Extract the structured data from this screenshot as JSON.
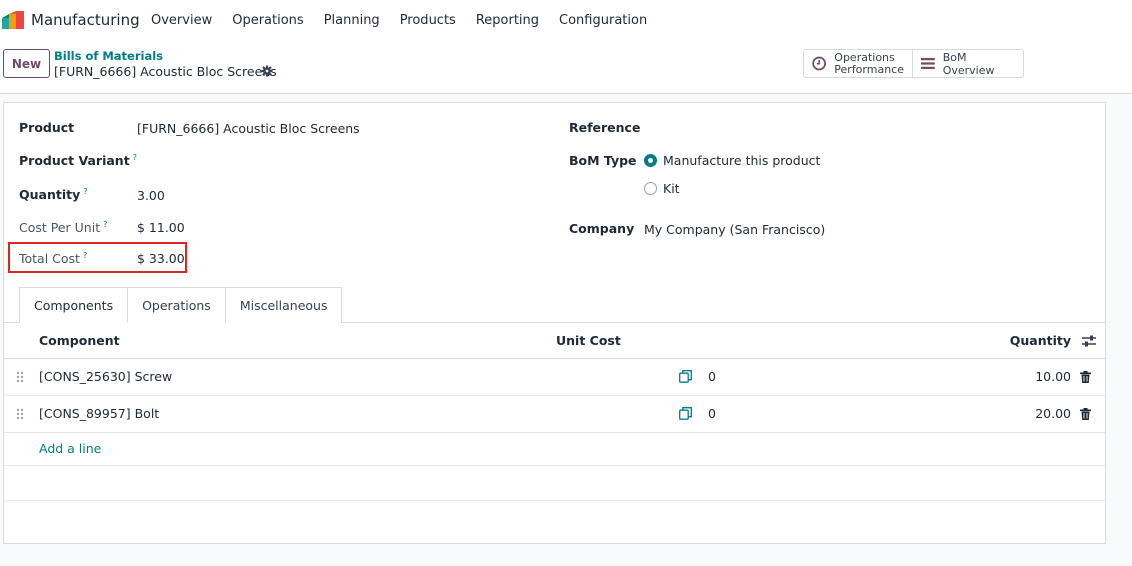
{
  "navbar": {
    "app_name": "Manufacturing",
    "menu": [
      "Overview",
      "Operations",
      "Planning",
      "Products",
      "Reporting",
      "Configuration"
    ]
  },
  "control_panel": {
    "new_label": "New",
    "breadcrumb_parent": "Bills of Materials",
    "breadcrumb_current": "[FURN_6666] Acoustic Bloc Screens",
    "stat_buttons": {
      "operations_line1": "Operations",
      "operations_line2": "Performance",
      "bom_overview": "BoM Overview"
    }
  },
  "form": {
    "product_label": "Product",
    "product_value": "[FURN_6666] Acoustic Bloc Screens",
    "variant_label": "Product Variant",
    "quantity_label": "Quantity",
    "quantity_value": "3.00",
    "cost_per_unit_label": "Cost Per Unit",
    "cost_per_unit_value": "$ 11.00",
    "total_cost_label": "Total Cost",
    "total_cost_value": "$ 33.00",
    "help_mark": "?",
    "reference_label": "Reference",
    "bom_type_label": "BoM Type",
    "bom_type_options": [
      "Manufacture this product",
      "Kit"
    ],
    "bom_type_selected": "Manufacture this product",
    "company_label": "Company",
    "company_value": "My Company (San Francisco)"
  },
  "tabs": [
    "Components",
    "Operations",
    "Miscellaneous"
  ],
  "active_tab": "Components",
  "components_table": {
    "headers": {
      "component": "Component",
      "unit_cost": "Unit Cost",
      "quantity": "Quantity"
    },
    "rows": [
      {
        "component": "[CONS_25630] Screw",
        "unit_cost": "0",
        "quantity": "10.00"
      },
      {
        "component": "[CONS_89957] Bolt",
        "unit_cost": "0",
        "quantity": "20.00"
      }
    ],
    "add_line_label": "Add a line"
  },
  "colors": {
    "accent": "#714b67",
    "link": "#017e84",
    "highlight": "#dc2626"
  }
}
